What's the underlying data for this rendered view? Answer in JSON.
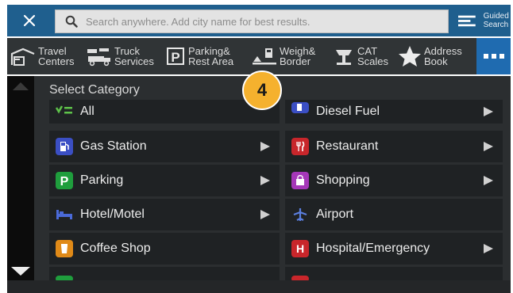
{
  "search": {
    "placeholder": "Search anywhere. Add city name for best results.",
    "guided_label": "Guided Search"
  },
  "toolbar": {
    "items": [
      {
        "line1": "Travel",
        "line2": "Centers",
        "icon": "travel-center-icon"
      },
      {
        "line1": "Truck",
        "line2": "Services",
        "icon": "truck-service-icon"
      },
      {
        "line1": "Parking&",
        "line2": "Rest Area",
        "icon": "parking-icon"
      },
      {
        "line1": "Weigh&",
        "line2": "Border",
        "icon": "weigh-station-icon"
      },
      {
        "line1": "CAT",
        "line2": "Scales",
        "icon": "scale-icon"
      },
      {
        "line1": "Address",
        "line2": "Book",
        "icon": "star-icon"
      }
    ],
    "more_icon": "more-dots-icon"
  },
  "panel": {
    "title": "Select Category"
  },
  "categories": {
    "left": [
      {
        "label": "All",
        "icon": "checklist-icon",
        "color": "#5ec24a",
        "has_arrow": false
      },
      {
        "label": "Gas Station",
        "icon": "gas-pump-icon",
        "color": "#3b4fc4",
        "has_arrow": true
      },
      {
        "label": "Parking",
        "icon": "parking-p-icon",
        "color": "#1f9e3d",
        "has_arrow": true
      },
      {
        "label": "Hotel/Motel",
        "icon": "bed-icon",
        "color": "#3a56c8",
        "has_arrow": true
      },
      {
        "label": "Coffee Shop",
        "icon": "coffee-cup-icon",
        "color": "#e08a18",
        "has_arrow": false
      }
    ],
    "right": [
      {
        "label": "Diesel Fuel",
        "icon": "diesel-pump-icon",
        "color": "#3b4fc4",
        "has_arrow": true
      },
      {
        "label": "Restaurant",
        "icon": "fork-knife-icon",
        "color": "#c8262b",
        "has_arrow": true
      },
      {
        "label": "Shopping",
        "icon": "shopping-bag-icon",
        "color": "#a537b8",
        "has_arrow": true
      },
      {
        "label": "Airport",
        "icon": "airplane-icon",
        "color": "#3c62c8",
        "has_arrow": false
      },
      {
        "label": "Hospital/Emergency",
        "icon": "hospital-h-icon",
        "color": "#c8262b",
        "has_arrow": true
      }
    ]
  },
  "callout": {
    "number": "4"
  }
}
